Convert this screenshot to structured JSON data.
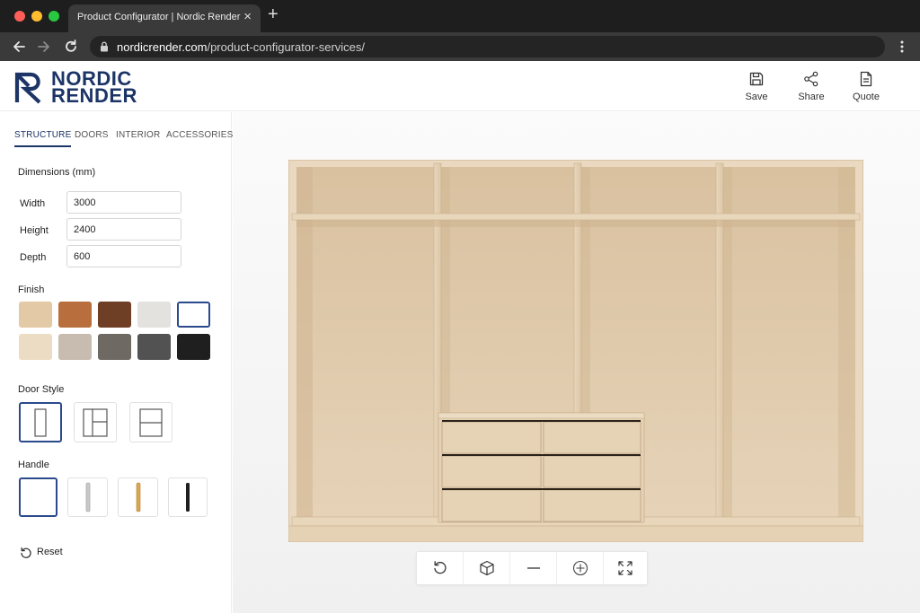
{
  "browser": {
    "tab_title": "Product Configurator | Nordic Render",
    "url_host": "nordicrender.com",
    "url_path": "/product-configurator-services/"
  },
  "header": {
    "logo_line1": "NORDIC",
    "logo_line2": "RENDER",
    "actions": [
      {
        "label": "Save",
        "icon": "save-icon"
      },
      {
        "label": "Share",
        "icon": "share-icon"
      },
      {
        "label": "Quote",
        "icon": "document-icon"
      }
    ]
  },
  "panel": {
    "tabs": [
      "STRUCTURE",
      "DOORS",
      "INTERIOR",
      "ACCESSORIES"
    ],
    "active_tab": "STRUCTURE",
    "dimensions_title": "Dimensions (mm)",
    "dimensions": [
      {
        "label": "Width",
        "value": "3000"
      },
      {
        "label": "Height",
        "value": "2400"
      },
      {
        "label": "Depth",
        "value": "600"
      }
    ],
    "finish_title": "Finish",
    "finish_colors": [
      "#e3c9a6",
      "#b86f3d",
      "#6e3f24",
      "#e4e2df",
      "#ffffff",
      "#ecdcc3",
      "#c7bcaf",
      "#6f6964",
      "#525252",
      "#1f1f1f"
    ],
    "finish_selected_index": 4,
    "door_style_title": "Door Style",
    "door_styles": [
      "single-panel-icon",
      "split-panel-icon",
      "horizontal-split-icon"
    ],
    "door_style_selected_index": 0,
    "handle_title": "Handle",
    "handles": [
      "no-handle",
      "chrome-bar-handle-icon",
      "brass-bar-handle-icon",
      "black-bar-handle-icon"
    ],
    "handle_selected_index": 0,
    "reset_label": "Reset"
  },
  "viewer": {
    "tools": [
      "rotate-icon",
      "cube-icon",
      "zoom-out-icon",
      "zoom-in-icon",
      "fullscreen-icon"
    ],
    "accent": "#1c3466",
    "wood_color": "#e3cfb2"
  }
}
